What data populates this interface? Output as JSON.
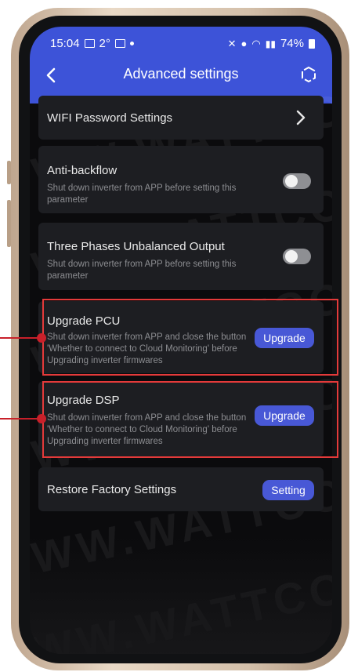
{
  "status_bar": {
    "time": "15:04",
    "temp": "2°",
    "battery": "74%"
  },
  "header": {
    "title": "Advanced settings",
    "back_icon": "back-arrow-icon",
    "refresh_icon": "refresh-icon"
  },
  "settings": {
    "wifi": {
      "label": "WIFI Password Settings"
    },
    "anti_backflow": {
      "label": "Anti-backflow",
      "desc": "Shut down inverter from APP before setting this parameter",
      "enabled": false
    },
    "three_phase": {
      "label": "Three Phases Unbalanced Output",
      "desc": "Shut down inverter from APP before setting this parameter",
      "enabled": false
    },
    "upgrade_pcu": {
      "label": "Upgrade PCU",
      "desc": "Shut down inverter from APP and close the button 'Whether to connect to Cloud Monitoring' before Upgrading inverter firmwares",
      "button": "Upgrade"
    },
    "upgrade_dsp": {
      "label": "Upgrade DSP",
      "desc": "Shut down inverter from APP and close the button 'Whether to connect to Cloud Monitoring' before Upgrading inverter firmwares",
      "button": "Upgrade"
    },
    "restore": {
      "label": "Restore Factory Settings",
      "button": "Setting"
    }
  },
  "watermark": "WWW.WATTCOMWW",
  "colors": {
    "accent": "#3d53d8",
    "button": "#4858d6",
    "highlight": "#e43a3a"
  }
}
